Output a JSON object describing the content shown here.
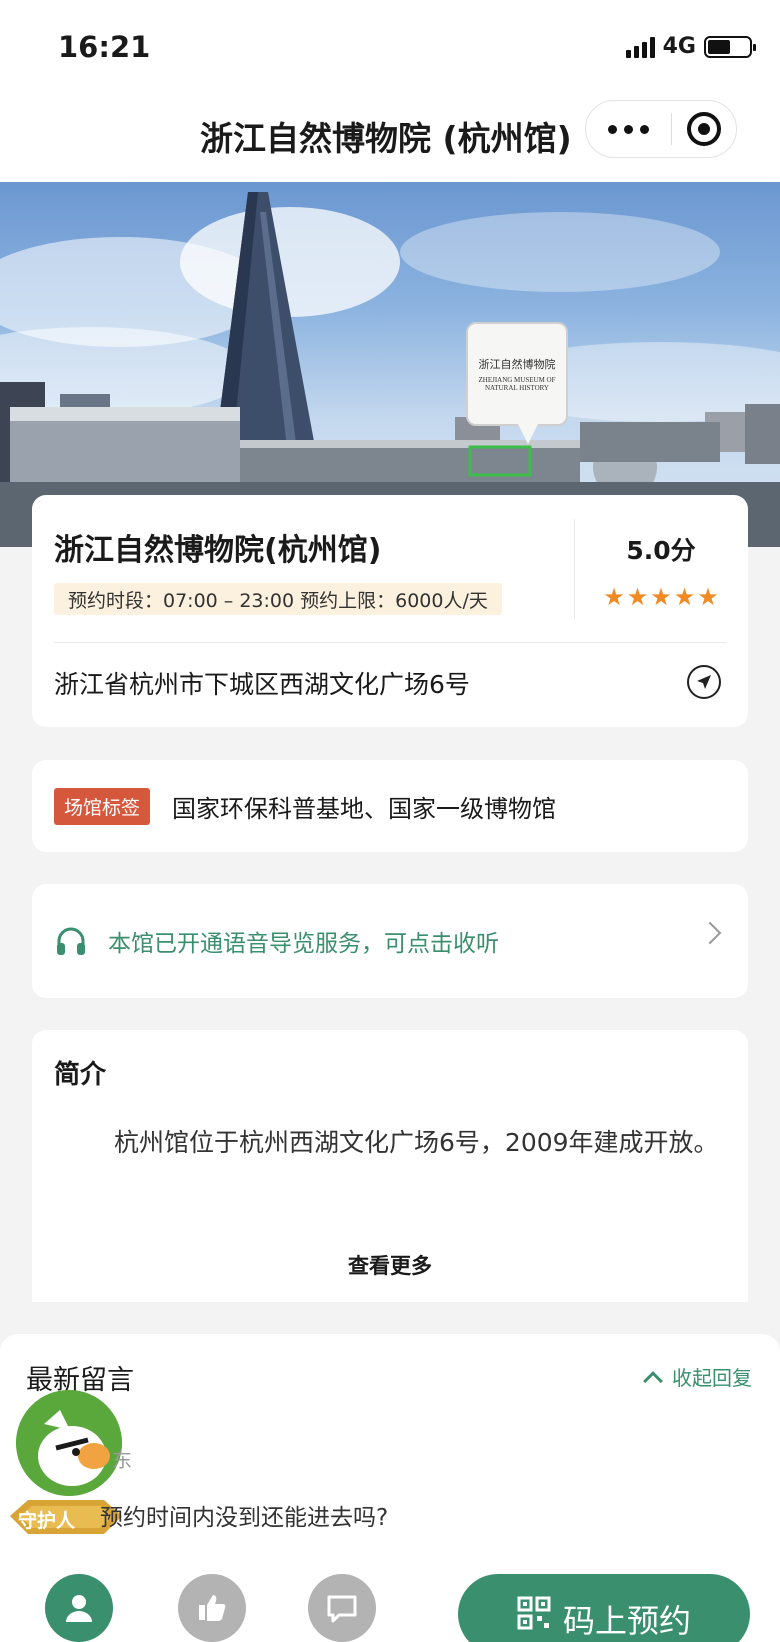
{
  "status_bar": {
    "time": "16:21",
    "network": "4G"
  },
  "nav": {
    "title": "浙江自然博物院 (杭州馆)"
  },
  "hero": {
    "sign_cn": "浙江自然博物院",
    "sign_en": "ZHEJIANG MUSEUM OF NATURAL HISTORY"
  },
  "venue": {
    "name": "浙江自然博物院(杭州馆)",
    "hours": "预约时段：07:00 – 23:00 预约上限：6000人/天",
    "score": "5.0分",
    "rating": 5,
    "address": "浙江省杭州市下城区西湖文化广场6号"
  },
  "tags": {
    "label": "场馆标签",
    "text": "国家环保科普基地、国家一级博物馆"
  },
  "audio_guide": {
    "text": "本馆已开通语音导览服务，可点击收听"
  },
  "intro": {
    "title": "简介",
    "body": "杭州馆位于杭州西湖文化广场6号，2009年建成开放。",
    "more_label": "查看更多"
  },
  "comments": {
    "title": "最新留言",
    "collapse_label": "收起回复",
    "items": [
      {
        "badge": "守护人",
        "user": "东",
        "text": "预约时间内没到还能进去吗?"
      }
    ]
  },
  "bottom_bar": {
    "book_label": "码上预约"
  },
  "colors": {
    "accent": "#3a8f6e",
    "tag_badge": "#d6583c",
    "star": "#f08a24",
    "hours_bg": "#fbf1de"
  }
}
